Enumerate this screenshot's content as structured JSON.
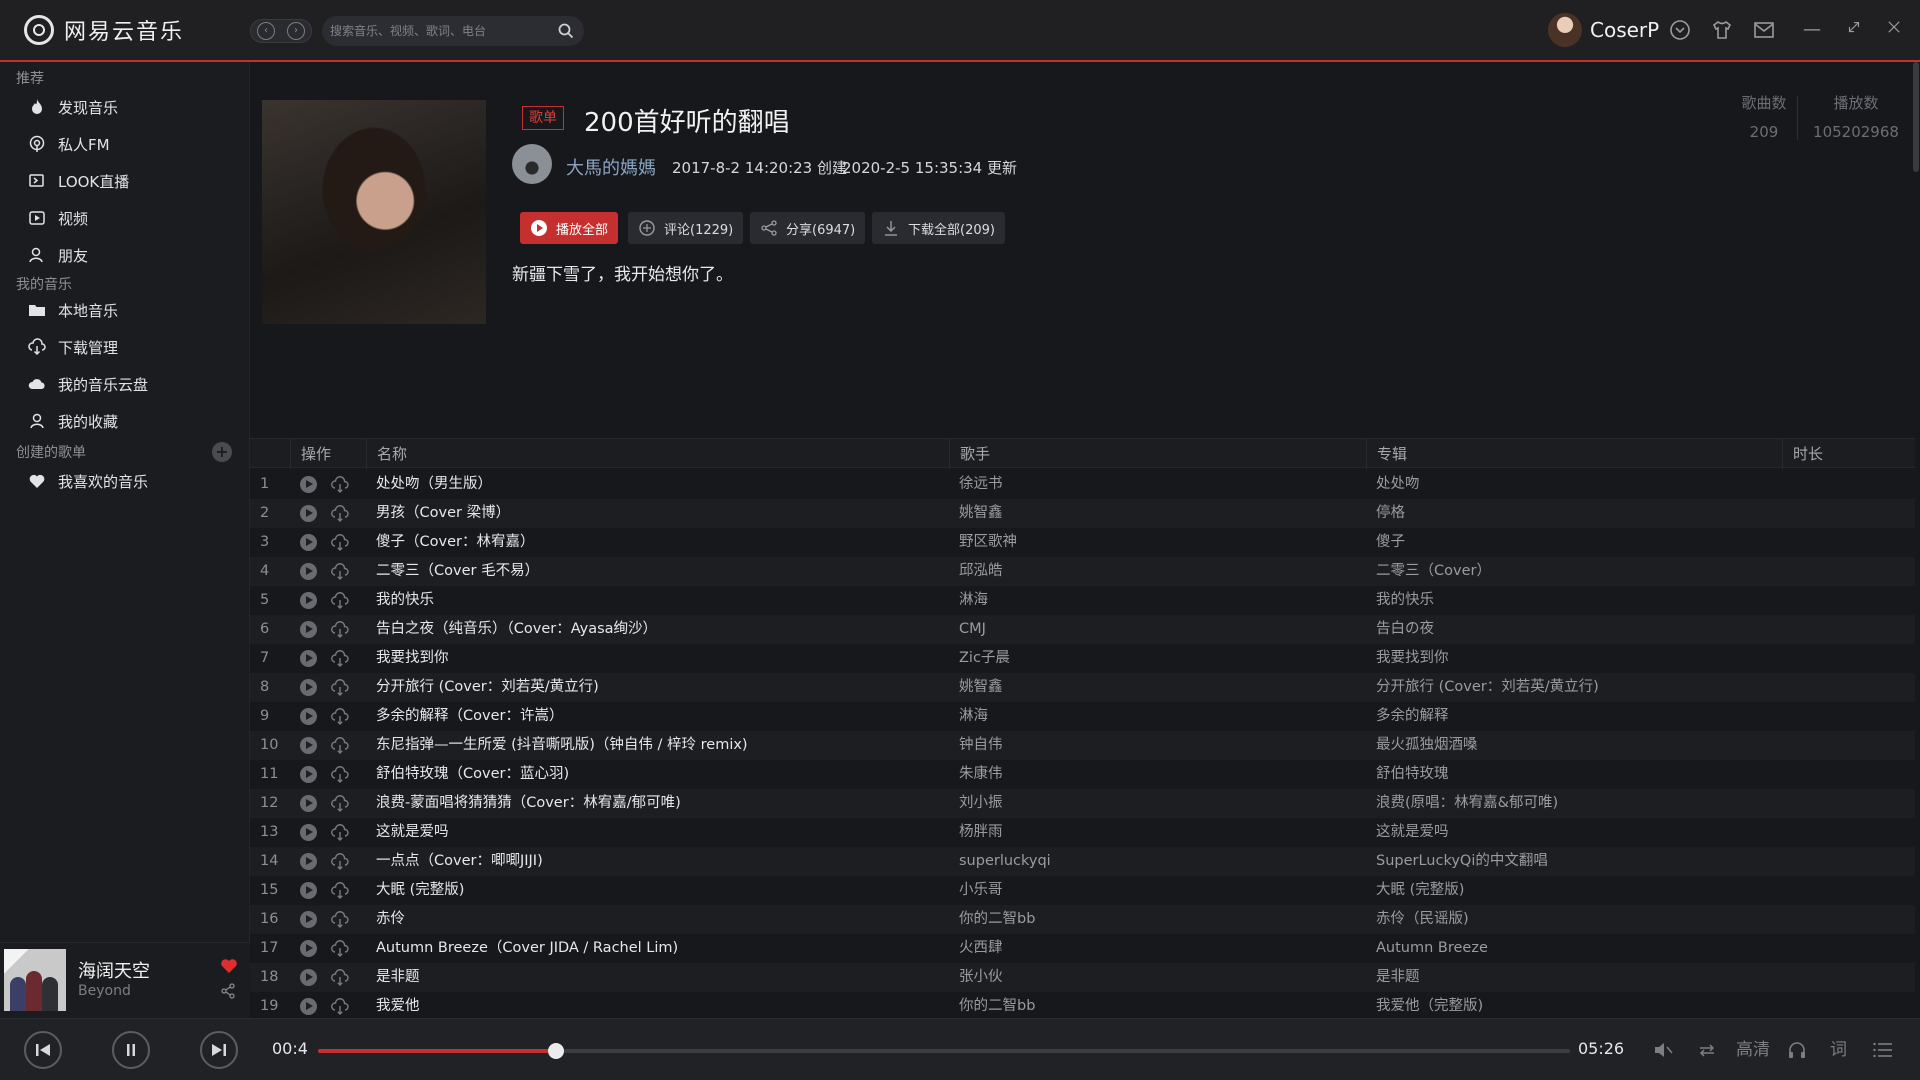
{
  "app": {
    "name": "网易云音乐"
  },
  "search": {
    "placeholder": "搜索音乐、视频、歌词、电台"
  },
  "user": {
    "name": "CoserP"
  },
  "sidebar": {
    "sections": [
      {
        "title": "推荐"
      },
      {
        "title": "我的音乐"
      },
      {
        "title": "创建的歌单"
      }
    ],
    "recommend": [
      {
        "label": "发现音乐",
        "icon": "fire-icon"
      },
      {
        "label": "私人FM",
        "icon": "radio-icon"
      },
      {
        "label": "LOOK直播",
        "icon": "live-icon"
      },
      {
        "label": "视频",
        "icon": "video-icon"
      },
      {
        "label": "朋友",
        "icon": "friends-icon"
      }
    ],
    "mymusic": [
      {
        "label": "本地音乐",
        "icon": "folder-icon"
      },
      {
        "label": "下载管理",
        "icon": "download-cloud-icon"
      },
      {
        "label": "我的音乐云盘",
        "icon": "cloud-icon"
      },
      {
        "label": "我的收藏",
        "icon": "user-icon"
      }
    ],
    "created": [
      {
        "label": "我喜欢的音乐",
        "icon": "heart-icon"
      }
    ]
  },
  "now_playing": {
    "title": "海阔天空",
    "artist": "Beyond"
  },
  "playlist": {
    "tag": "歌单",
    "title": "200首好听的翻唱",
    "creator": "大馬的媽媽",
    "created": "2017-8-2 14:20:23 创建",
    "updated": "2020-2-5 15:35:34 更新",
    "buttons": {
      "play_all": "播放全部",
      "comment": "评论(1229)",
      "share": "分享(6947)",
      "download": "下载全部(209)"
    },
    "description": "新疆下雪了，我开始想你了。",
    "stats": {
      "songs_label": "歌曲数",
      "songs": "209",
      "plays_label": "播放数",
      "plays": "105202968"
    }
  },
  "table": {
    "headers": {
      "ops": "操作",
      "name": "名称",
      "singer": "歌手",
      "album": "专辑",
      "duration": "时长"
    },
    "rows": [
      {
        "idx": "1",
        "name": "处处吻（男生版）",
        "singer": "徐远书",
        "album": "处处吻"
      },
      {
        "idx": "2",
        "name": "男孩（Cover 梁博）",
        "singer": "姚智鑫",
        "album": "停格"
      },
      {
        "idx": "3",
        "name": "傻子（Cover：林宥嘉）",
        "singer": "野区歌神",
        "album": "傻子"
      },
      {
        "idx": "4",
        "name": "二零三（Cover 毛不易）",
        "singer": "邱泓皓",
        "album": "二零三（Cover）"
      },
      {
        "idx": "5",
        "name": "我的快乐",
        "singer": "淋海",
        "album": "我的快乐"
      },
      {
        "idx": "6",
        "name": "告白之夜（纯音乐）（Cover：Ayasa绚沙）",
        "singer": "CMJ",
        "album": "告白の夜"
      },
      {
        "idx": "7",
        "name": "我要找到你",
        "singer": "Zic子晨",
        "album": "我要找到你"
      },
      {
        "idx": "8",
        "name": "分开旅行 (Cover：刘若英/黄立行)",
        "singer": "姚智鑫",
        "album": "分开旅行 (Cover：刘若英/黄立行)"
      },
      {
        "idx": "9",
        "name": "多余的解释（Cover：许嵩）",
        "singer": "淋海",
        "album": "多余的解释"
      },
      {
        "idx": "10",
        "name": "东尼指弹—一生所爱 (抖音嘶吼版)（钟自伟 / 梓玲 remix)",
        "singer": "钟自伟",
        "album": "最火孤独烟酒嗓"
      },
      {
        "idx": "11",
        "name": "舒伯特玫瑰（Cover：蓝心羽)",
        "singer": "朱康伟",
        "album": "舒伯特玫瑰"
      },
      {
        "idx": "12",
        "name": "浪费-蒙面唱将猜猜猜（Cover：林宥嘉/郁可唯)",
        "singer": "刘小振",
        "album": "浪费(原唱：林宥嘉&郁可唯)"
      },
      {
        "idx": "13",
        "name": "这就是爱吗",
        "singer": "杨胖雨",
        "album": "这就是爱吗"
      },
      {
        "idx": "14",
        "name": "一点点（Cover：唧唧JIJI)",
        "singer": "superluckyqi",
        "album": "SuperLuckyQi的中文翻唱"
      },
      {
        "idx": "15",
        "name": "大眠 (完整版)",
        "singer": "小乐哥",
        "album": "大眠 (完整版)"
      },
      {
        "idx": "16",
        "name": "赤伶",
        "singer": "你的二智bb",
        "album": "赤伶（民谣版)"
      },
      {
        "idx": "17",
        "name": "Autumn Breeze（Cover JIDA / Rachel Lim)",
        "singer": "火西肆",
        "album": "Autumn Breeze"
      },
      {
        "idx": "18",
        "name": "是非题",
        "singer": "张小伙",
        "album": "是非题"
      },
      {
        "idx": "19",
        "name": "我爱他",
        "singer": "你的二智bb",
        "album": "我爱他（完整版)"
      }
    ]
  },
  "player": {
    "current_time": "00:4",
    "total_time": "05:26",
    "progress": 0.19,
    "quality": "高清",
    "lyrics": "词"
  },
  "colors": {
    "accent": "#c62f2f",
    "bg": "#16181c",
    "sidebar": "#1b1c20"
  }
}
